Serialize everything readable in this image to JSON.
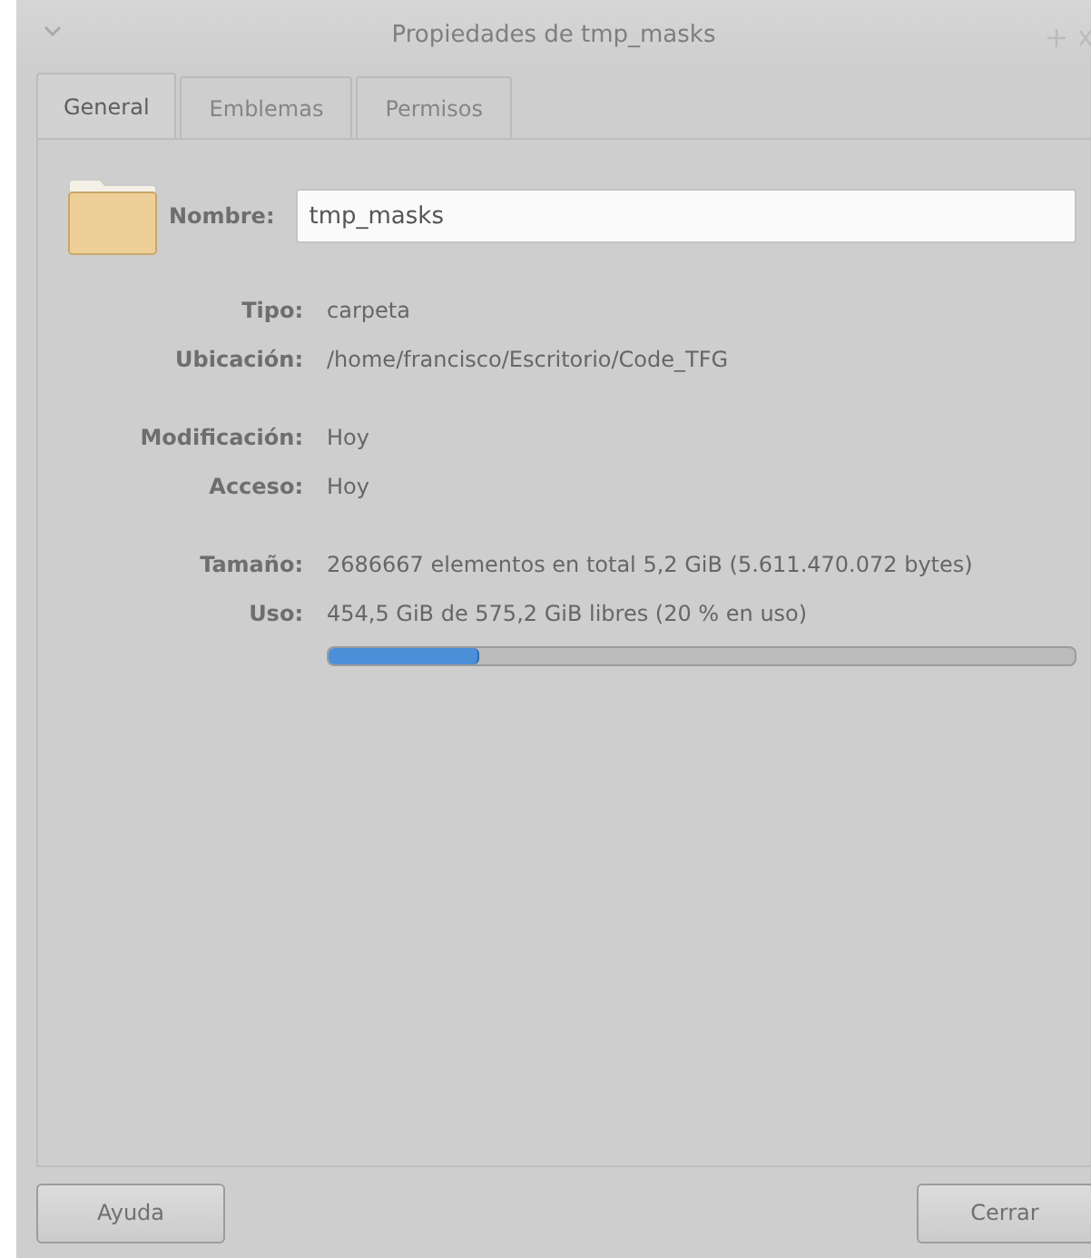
{
  "window": {
    "title": "Propiedades de tmp_masks"
  },
  "tabs": [
    {
      "label": "General",
      "selected": true
    },
    {
      "label": "Emblemas",
      "selected": false
    },
    {
      "label": "Permisos",
      "selected": false
    }
  ],
  "name_field": {
    "label": "Nombre:",
    "value": "tmp_masks"
  },
  "groups": [
    [
      {
        "label": "Tipo:",
        "value": "carpeta"
      },
      {
        "label": "Ubicación:",
        "value": "/home/francisco/Escritorio/Code_TFG"
      }
    ],
    [
      {
        "label": "Modificación:",
        "value": "Hoy"
      },
      {
        "label": "Acceso:",
        "value": "Hoy"
      }
    ],
    [
      {
        "label": "Tamaño:",
        "value": "2686667 elementos en total 5,2 GiB (5.611.470.072 bytes)"
      },
      {
        "label": "Uso:",
        "value": "454,5 GiB de 575,2 GiB libres (20 % en uso)",
        "level": 0.2
      }
    ]
  ],
  "buttons": [
    {
      "label": "Ayuda"
    },
    {
      "label": "Cerrar"
    }
  ]
}
